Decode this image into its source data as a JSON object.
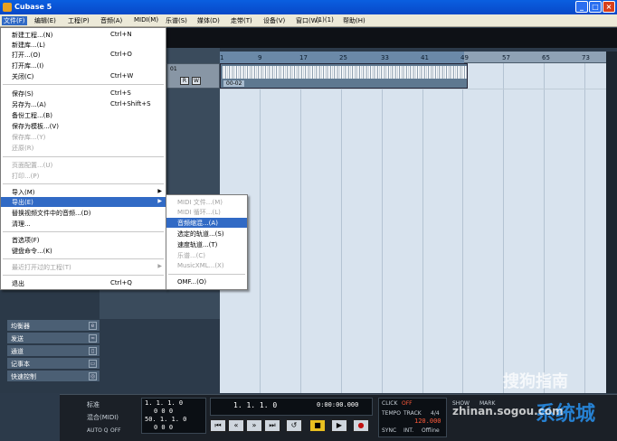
{
  "window": {
    "title": "Cubase 5",
    "min": "_",
    "max": "□",
    "close": "×"
  },
  "menubar": [
    "文件(F)",
    "编辑(E)",
    "工程(P)",
    "音频(A)",
    "MIDI(M)",
    "乐谱(S)",
    "媒体(D)",
    "走带(T)",
    "设备(V)",
    "窗口(W)",
    "(1)(1)",
    "帮助(H)"
  ],
  "file_menu": {
    "items": [
      {
        "label": "新建工程...(N)",
        "shortcut": "Ctrl+N"
      },
      {
        "label": "新建库...(L)",
        "shortcut": ""
      },
      {
        "label": "打开...(O)",
        "shortcut": "Ctrl+O"
      },
      {
        "label": "打开库...(I)",
        "shortcut": ""
      },
      {
        "label": "关闭(C)",
        "shortcut": "Ctrl+W"
      },
      {
        "label": "保存(S)",
        "shortcut": "Ctrl+S"
      },
      {
        "label": "另存为...(A)",
        "shortcut": "Ctrl+Shift+S"
      },
      {
        "label": "备份工程...(B)",
        "shortcut": ""
      },
      {
        "label": "保存为模板...(V)",
        "shortcut": ""
      },
      {
        "label": "保存库...(Y)",
        "shortcut": ""
      },
      {
        "label": "还原(R)",
        "shortcut": ""
      },
      {
        "label": "页面配置...(U)",
        "shortcut": ""
      },
      {
        "label": "打印...(P)",
        "shortcut": ""
      },
      {
        "label": "导入(M)",
        "shortcut": ""
      },
      {
        "label": "导出(E)",
        "shortcut": ""
      },
      {
        "label": "替换视频文件中的音频...(D)",
        "shortcut": ""
      },
      {
        "label": "清理...",
        "shortcut": ""
      },
      {
        "label": "首选项(F)",
        "shortcut": ""
      },
      {
        "label": "键盘命令...(K)",
        "shortcut": ""
      },
      {
        "label": "最近打开过的工程(T)",
        "shortcut": ""
      },
      {
        "label": "退出",
        "shortcut": "Ctrl+Q"
      }
    ]
  },
  "export_submenu": {
    "items": [
      {
        "label": "MIDI 文件...(M)"
      },
      {
        "label": "MIDI 循环...(L)"
      },
      {
        "label": "音频缩混...(A)"
      },
      {
        "label": "选定的轨道...(S)"
      },
      {
        "label": "速度轨道...(T)"
      },
      {
        "label": "乐谱...(C)"
      },
      {
        "label": "MusicXML...(X)"
      },
      {
        "label": "OMF...(O)"
      }
    ]
  },
  "ruler": {
    "ticks": [
      "1",
      "9",
      "17",
      "25",
      "33",
      "41",
      "49",
      "57",
      "65",
      "73"
    ]
  },
  "track": {
    "number": "01",
    "read": "R",
    "write": "W",
    "event_name": "00-02"
  },
  "inspector": [
    {
      "label": "均衡器",
      "icon": "e"
    },
    {
      "label": "发送",
      "icon": "≈"
    },
    {
      "label": "通道",
      "icon": "▯"
    },
    {
      "label": "记事本",
      "icon": "▭"
    },
    {
      "label": "快速控制",
      "icon": "◎"
    }
  ],
  "transport": {
    "mode1": "标准",
    "mode2": "混合(MIDI)",
    "auto_q": "AUTO Q",
    "off": "OFF",
    "left_loc": "1. 1. 1.   0",
    "left_loc_sub": "0  0  0",
    "right_loc": "50. 1. 1.   0",
    "right_loc_sub": "0  0  0",
    "position": "1. 1. 1.   0",
    "time": "0:00:00.000",
    "click": "CLICK",
    "click_state": "OFF",
    "tempo": "TEMPO",
    "track": "TRACK",
    "sig": "4/4",
    "bpm": "120.000",
    "sync": "SYNC",
    "int": "INT.",
    "offline": "Offline",
    "show": "SHOW",
    "marker": "MARK"
  },
  "watermark": {
    "sogou": "搜狗指南",
    "site_cn": "系统城",
    "url": "zhinan.sogou.com"
  }
}
